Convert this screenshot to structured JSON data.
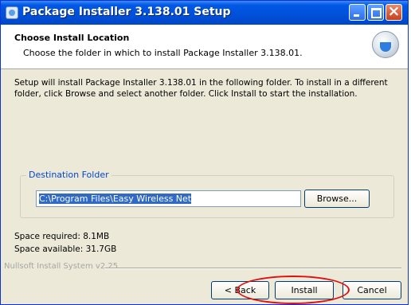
{
  "window": {
    "title": "Package Installer 3.138.01 Setup"
  },
  "header": {
    "title": "Choose Install Location",
    "subtitle": "Choose the folder in which to install Package Installer 3.138.01."
  },
  "body": {
    "intro_line1": "Setup will install Package Installer 3.138.01 in the following folder. To install in a different",
    "intro_line2": "folder, click Browse and select another folder. Click Install to start the installation."
  },
  "destination": {
    "legend": "Destination Folder",
    "path": "C:\\Program Files\\Easy Wireless Net",
    "browse_label": "Browse..."
  },
  "space": {
    "required": "Space required: 8.1MB",
    "available": "Space available: 31.7GB"
  },
  "footer": {
    "branding": "Nullsoft Install System v2.25",
    "back_label": "< Back",
    "install_label": "Install",
    "cancel_label": "Cancel"
  },
  "colors": {
    "annotation": "#e01010",
    "titlebar": "#0058e6",
    "selection": "#316ac5"
  }
}
